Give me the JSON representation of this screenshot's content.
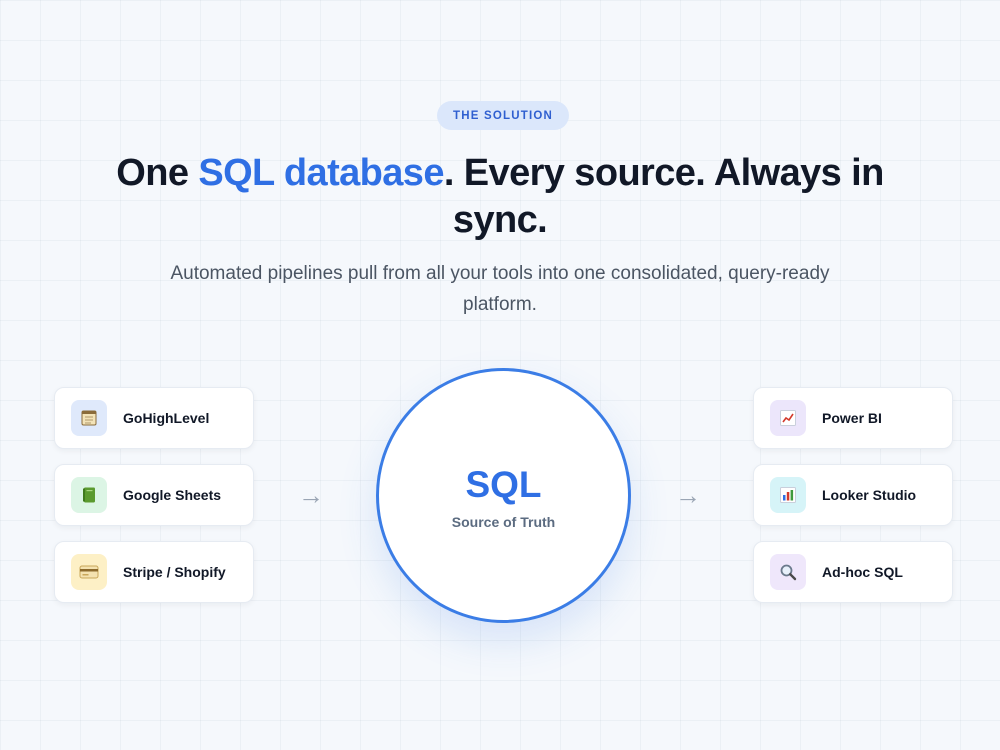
{
  "badge": "THE SOLUTION",
  "headline": {
    "part1": "One ",
    "highlight": "SQL database",
    "part2": ". Every source. Always in sync."
  },
  "subtitle": "Automated pipelines pull from all your tools into one consolidated, query-ready platform.",
  "hub": {
    "title": "SQL",
    "subtitle": "Source of Truth"
  },
  "sources": [
    {
      "label": "GoHighLevel",
      "icon": "notepad-icon"
    },
    {
      "label": "Google Sheets",
      "icon": "green-book-icon"
    },
    {
      "label": "Stripe / Shopify",
      "icon": "credit-card-icon"
    }
  ],
  "destinations": [
    {
      "label": "Power BI",
      "icon": "line-chart-icon"
    },
    {
      "label": "Looker Studio",
      "icon": "bar-chart-icon"
    },
    {
      "label": "Ad-hoc SQL",
      "icon": "magnifier-icon"
    }
  ],
  "arrow_glyph": "→",
  "colors": {
    "accent": "#2f6fe4",
    "badge_bg": "#dbe7fb",
    "hub_border": "#3b7de6"
  }
}
